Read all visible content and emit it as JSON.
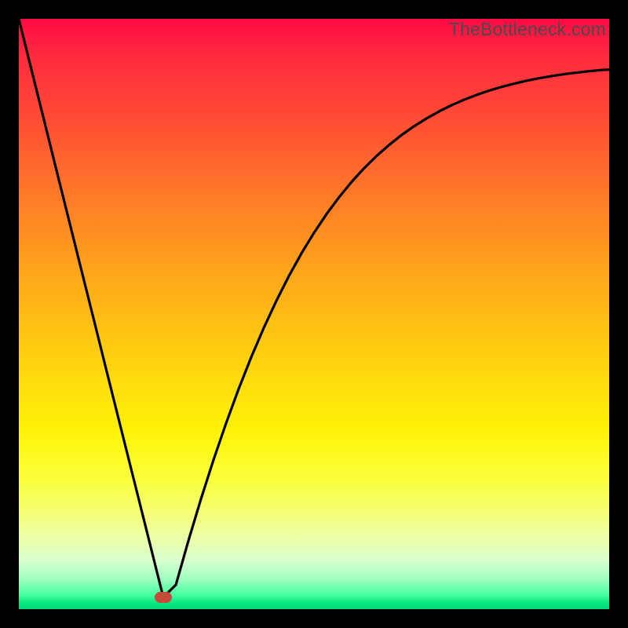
{
  "watermark": {
    "text": "TheBottleneck.com"
  },
  "colors": {
    "curve": "#000000",
    "dot": "#c44a3a",
    "frame_bg": "#000000"
  },
  "chart_data": {
    "type": "line",
    "title": "",
    "xlabel": "",
    "ylabel": "",
    "xlim": [
      0,
      100
    ],
    "ylim": [
      0,
      100
    ],
    "grid": false,
    "legend": false,
    "annotations": [],
    "series": [
      {
        "name": "bottleneck-curve",
        "x": [
          0.0,
          2.13,
          4.26,
          6.38,
          8.51,
          10.64,
          12.77,
          14.89,
          17.02,
          19.15,
          21.28,
          23.4,
          24.07,
          24.47,
          26.6,
          28.72,
          30.85,
          32.98,
          35.11,
          37.23,
          39.36,
          41.49,
          43.62,
          45.74,
          47.87,
          50.0,
          52.13,
          54.26,
          56.38,
          58.51,
          60.64,
          62.77,
          64.89,
          67.02,
          69.15,
          71.28,
          73.4,
          75.53,
          77.66,
          79.79,
          81.91,
          84.04,
          86.17,
          88.3,
          90.43,
          92.55,
          94.68,
          96.81,
          98.94,
          100.0
        ],
        "y": [
          100,
          91.43,
          82.88,
          74.34,
          65.81,
          57.28,
          48.77,
          40.26,
          31.75,
          23.26,
          14.77,
          6.28,
          3.62,
          2.02,
          4.12,
          11.58,
          18.65,
          25.29,
          31.5,
          37.29,
          42.67,
          47.64,
          52.22,
          56.42,
          60.26,
          63.75,
          66.93,
          69.8,
          72.39,
          74.72,
          76.81,
          78.68,
          80.36,
          81.85,
          83.18,
          84.36,
          85.41,
          86.34,
          87.16,
          87.88,
          88.51,
          89.06,
          89.55,
          89.97,
          90.33,
          90.65,
          90.92,
          91.15,
          91.35,
          91.4
        ]
      }
    ],
    "marker": {
      "x": 24.47,
      "y": 2.02
    }
  }
}
